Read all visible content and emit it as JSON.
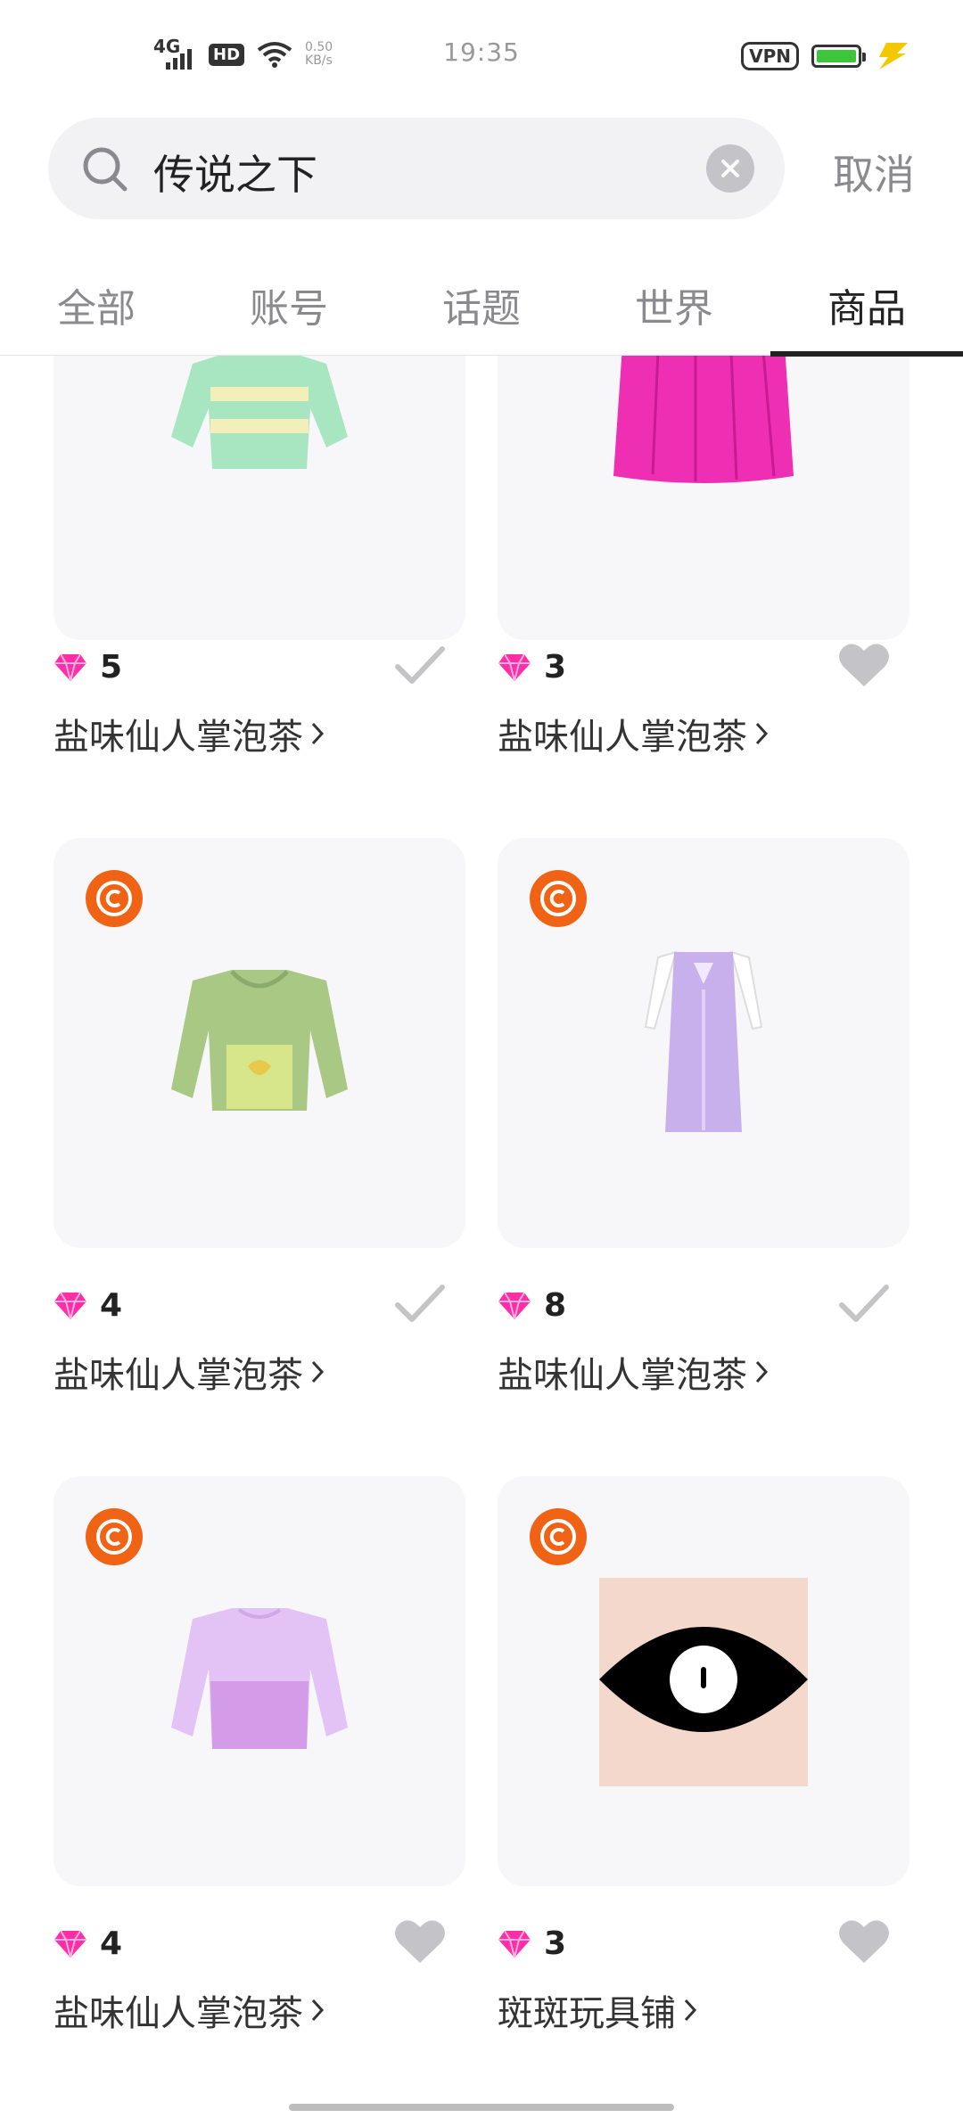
{
  "status_bar": {
    "network": "4G",
    "hd": "HD",
    "speed_value": "0.50",
    "speed_unit": "KB/s",
    "time": "19:35",
    "vpn": "VPN"
  },
  "search": {
    "query": "传说之下",
    "cancel_label": "取消"
  },
  "tabs": [
    {
      "label": "全部",
      "active": false
    },
    {
      "label": "账号",
      "active": false
    },
    {
      "label": "话题",
      "active": false
    },
    {
      "label": "世界",
      "active": false
    },
    {
      "label": "商品",
      "active": true
    }
  ],
  "products": [
    {
      "item": "mint striped sweater",
      "price": "5",
      "shop": "盐味仙人掌泡茶",
      "action": "check",
      "copyright_badge": false
    },
    {
      "item": "pink pleated skirt",
      "price": "3",
      "shop": "盐味仙人掌泡茶",
      "action": "heart",
      "copyright_badge": false
    },
    {
      "item": "green hoodie with heart locket",
      "price": "4",
      "shop": "盐味仙人掌泡茶",
      "action": "check",
      "copyright_badge": true
    },
    {
      "item": "purple robe with white sleeves",
      "price": "8",
      "shop": "盐味仙人掌泡茶",
      "action": "check",
      "copyright_badge": true
    },
    {
      "item": "lilac sweater",
      "price": "4",
      "shop": "盐味仙人掌泡茶",
      "action": "heart",
      "copyright_badge": true
    },
    {
      "item": "black eye with white pupil",
      "price": "3",
      "shop": "斑斑玩具铺",
      "action": "heart",
      "copyright_badge": true
    }
  ],
  "colors": {
    "accent_badge": "#f06315",
    "gem": "#ff2ea6",
    "battery": "#3ec53e",
    "bolt": "#f3c800"
  }
}
